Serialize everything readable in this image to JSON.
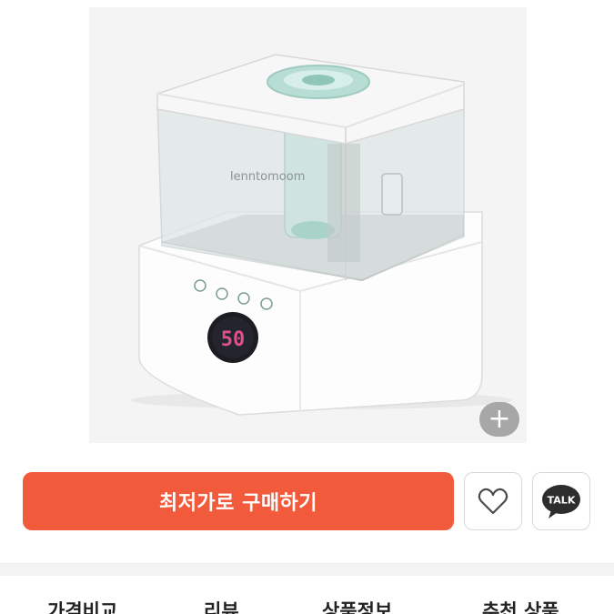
{
  "product": {
    "image_alt": "Humidifier product image",
    "device_display": "50",
    "zoom_label": "+"
  },
  "actions": {
    "buy_label": "최저가로 구매하기",
    "wish_icon": "heart-icon",
    "talk_label": "TALK"
  },
  "tabs": [
    {
      "label": "가격비교"
    },
    {
      "label": "리뷰"
    },
    {
      "label": "상품정보"
    },
    {
      "label": "추천 상품"
    }
  ]
}
